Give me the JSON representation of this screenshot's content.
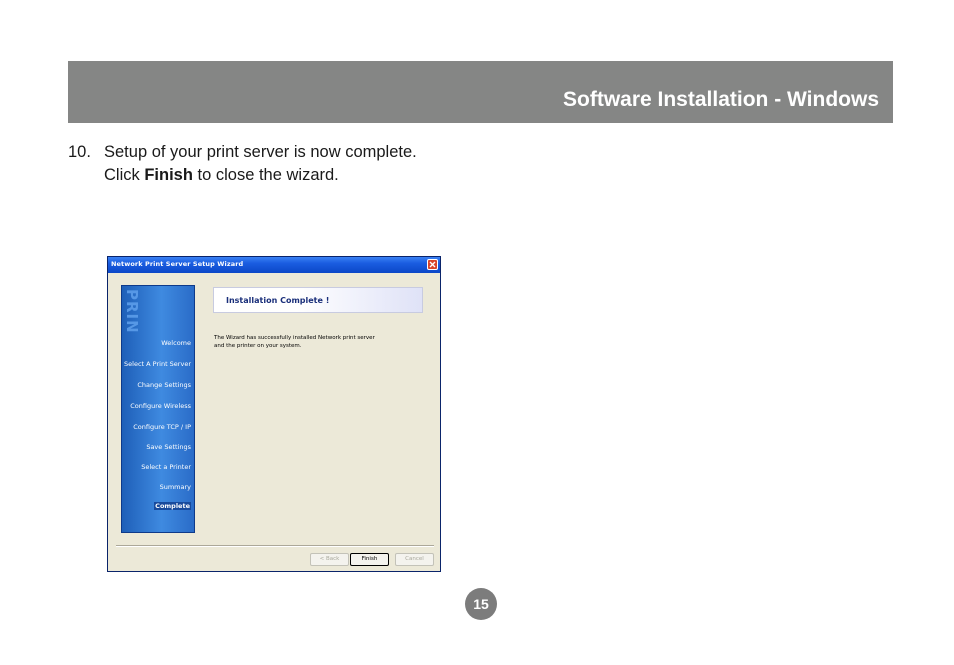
{
  "header": {
    "title": "Software Installation - Windows",
    "band_color": "#858685"
  },
  "step": {
    "number": "10.",
    "line1": "Setup of your print server is now complete.",
    "line2_prefix": "Click ",
    "line2_bold": "Finish",
    "line2_suffix": " to close the wizard."
  },
  "dialog": {
    "title": "Network Print Server Setup Wizard",
    "watermark": "PRIN",
    "nav_items": [
      {
        "label": "Welcome",
        "active": false
      },
      {
        "label": "Select A Print Server",
        "active": false
      },
      {
        "label": "Change Settings",
        "active": false
      },
      {
        "label": "Configure Wireless",
        "active": false
      },
      {
        "label": "Configure TCP / IP",
        "active": false
      },
      {
        "label": "Save Settings",
        "active": false
      },
      {
        "label": "Select a Printer",
        "active": false
      },
      {
        "label": "Summary",
        "active": false
      },
      {
        "label": "Complete",
        "active": true
      }
    ],
    "banner_title": "Installation Complete !",
    "message_line1": "The Wizard has successfully installed Network print server",
    "message_line2": "and the printer on your system.",
    "buttons": {
      "back": "< Back",
      "finish": "Finish",
      "cancel": "Cancel"
    }
  },
  "page_number": "15"
}
